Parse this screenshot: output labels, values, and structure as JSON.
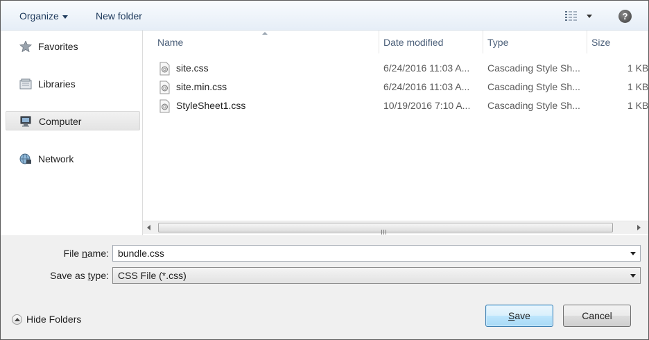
{
  "toolbar": {
    "organize_label": "Organize",
    "new_folder_label": "New folder",
    "views_icon": "details-view-icon",
    "help_icon": "help-icon",
    "help_glyph": "?"
  },
  "nav": {
    "items": [
      {
        "label": "Favorites",
        "icon": "star-icon",
        "selected": false
      },
      {
        "label": "Libraries",
        "icon": "libraries-icon",
        "selected": false
      },
      {
        "label": "Computer",
        "icon": "computer-icon",
        "selected": true
      },
      {
        "label": "Network",
        "icon": "network-icon",
        "selected": false
      }
    ]
  },
  "file_list": {
    "columns": [
      "Name",
      "Date modified",
      "Type",
      "Size"
    ],
    "rows": [
      {
        "name": "site.css",
        "date": "6/24/2016 11:03 A...",
        "type": "Cascading Style Sh...",
        "size": "1 KB"
      },
      {
        "name": "site.min.css",
        "date": "6/24/2016 11:03 A...",
        "type": "Cascading Style Sh...",
        "size": "1 KB"
      },
      {
        "name": "StyleSheet1.css",
        "date": "10/19/2016 7:10 A...",
        "type": "Cascading Style Sh...",
        "size": "1 KB"
      }
    ]
  },
  "form": {
    "file_name_label_pre": "File ",
    "file_name_label_key": "n",
    "file_name_label_post": "ame:",
    "file_name_value": "bundle.css",
    "save_type_label_pre": "Save as ",
    "save_type_label_key": "t",
    "save_type_label_post": "ype:",
    "save_type_value": "CSS File (*.css)"
  },
  "footer": {
    "hide_folders_label": "Hide Folders",
    "save_label_key": "S",
    "save_label_rest": "ave",
    "cancel_label": "Cancel"
  },
  "colors": {
    "toolbar_text": "#1e3a5c",
    "column_header_text": "#4c607a",
    "save_button_border": "#3c7fb1"
  }
}
